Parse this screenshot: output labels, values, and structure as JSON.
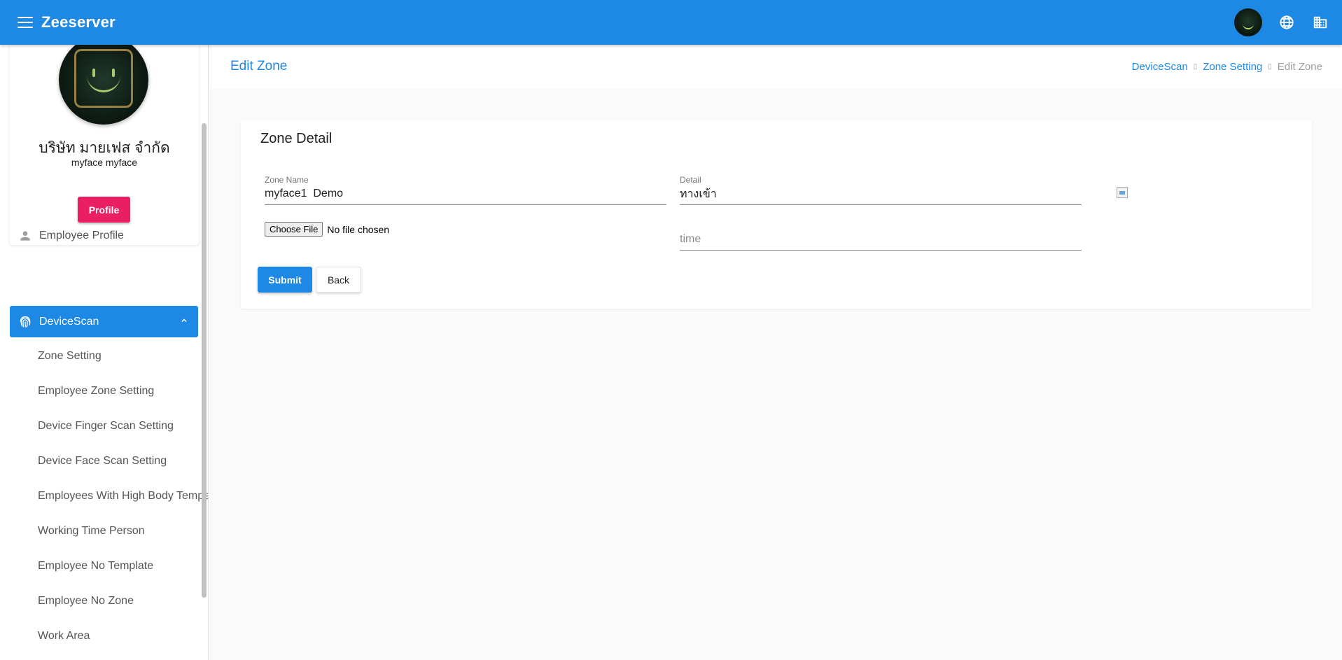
{
  "topbar": {
    "brand": "Zeeserver",
    "icons": [
      "menu-icon",
      "user-avatar",
      "globe-icon",
      "building-icon"
    ]
  },
  "sidebar": {
    "company_name": "บริษัท มายเฟส จำกัด",
    "username": "myface myface",
    "profile_button": "Profile",
    "items": [
      {
        "label": "Employee Profile",
        "icon": "person-icon"
      },
      {
        "label": "DeviceScan",
        "icon": "fingerprint-icon",
        "active": true,
        "expanded": true
      }
    ],
    "sub_items": [
      "Zone Setting",
      "Employee Zone Setting",
      "Device Finger Scan Setting",
      "Device Face Scan Setting",
      "Employees With High Body Tempe",
      "Working Time Person",
      "Employee No Template",
      "Employee No Zone",
      "Work Area"
    ]
  },
  "header": {
    "title": "Edit Zone",
    "breadcrumb": {
      "links": [
        "DeviceScan",
        "Zone Setting"
      ],
      "current": "Edit Zone"
    }
  },
  "card": {
    "title": "Zone Detail",
    "zone_name": {
      "label": "Zone Name",
      "value": "myface1  Demo"
    },
    "detail": {
      "label": "Detail",
      "value": "ทางเข้า"
    },
    "time": {
      "placeholder": "time",
      "value": ""
    },
    "file": {
      "button": "Choose File",
      "status": "No file chosen"
    },
    "submit": "Submit",
    "back": "Back"
  },
  "colors": {
    "primary": "#1e88e5",
    "accent": "#e91e63",
    "background": "#fafafa"
  }
}
